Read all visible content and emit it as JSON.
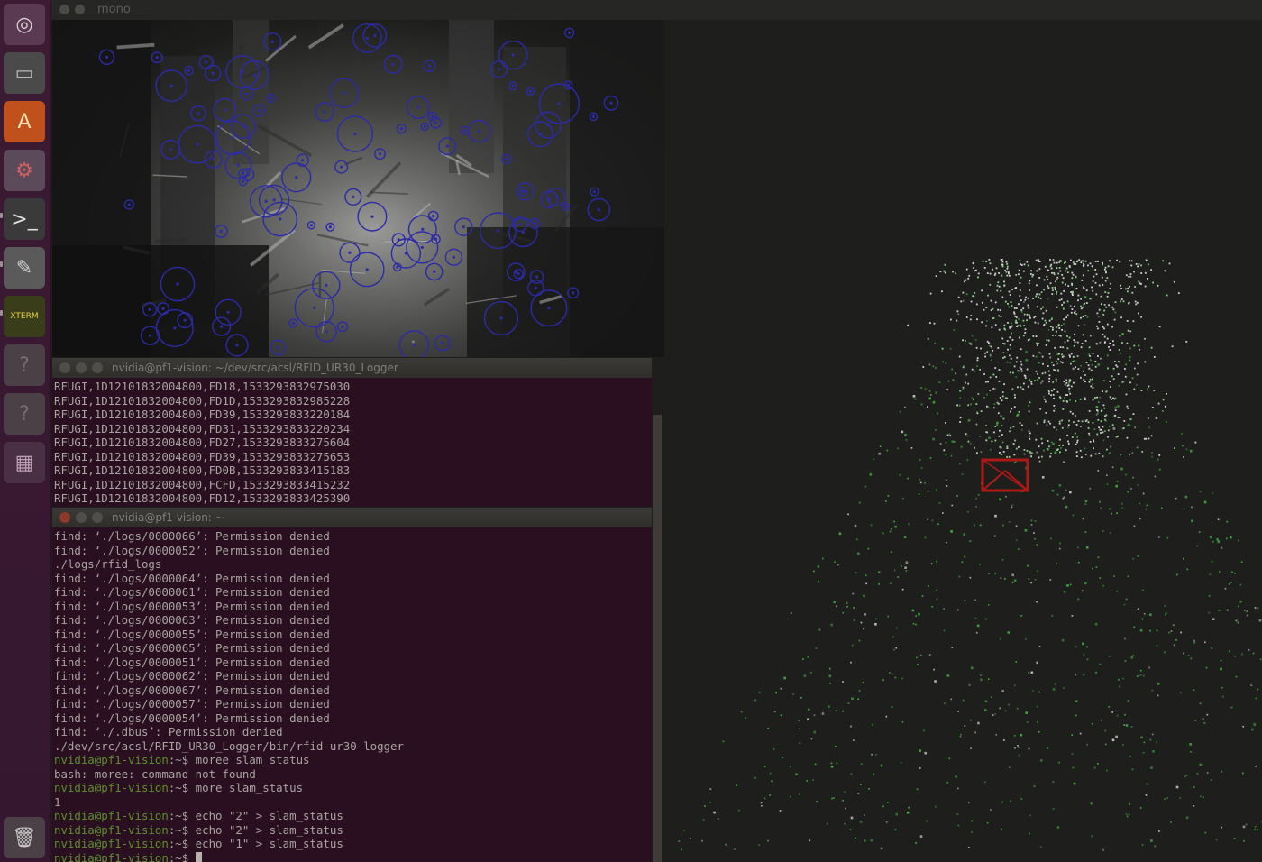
{
  "top_panel": {
    "title": "mono"
  },
  "launcher": {
    "items": [
      {
        "name": "dash-home-icon",
        "glyph": "◎"
      },
      {
        "name": "file-manager-icon",
        "glyph": "▭"
      },
      {
        "name": "software-center-icon",
        "glyph": "A"
      },
      {
        "name": "system-settings-icon",
        "glyph": "⚙"
      },
      {
        "name": "terminal-icon",
        "glyph": ">_"
      },
      {
        "name": "text-editor-icon",
        "glyph": "✎"
      },
      {
        "name": "xterm-icon",
        "glyph": "XTERM"
      },
      {
        "name": "unknown-app-icon",
        "glyph": "?"
      },
      {
        "name": "unknown-app-icon-2",
        "glyph": "?"
      },
      {
        "name": "workspace-switcher-icon",
        "glyph": "▦"
      },
      {
        "name": "trash-icon",
        "glyph": "🗑"
      }
    ]
  },
  "logger_terminal": {
    "title": "nvidia@pf1-vision: ~/dev/src/acsl/RFID_UR30_Logger",
    "lines": [
      "RFUGI,1D12101832004800,FD18,1533293832975030",
      "RFUGI,1D12101832004800,FD1D,1533293832985228",
      "RFUGI,1D12101832004800,FD39,1533293833220184",
      "RFUGI,1D12101832004800,FD31,1533293833220234",
      "RFUGI,1D12101832004800,FD27,1533293833275604",
      "RFUGI,1D12101832004800,FD39,1533293833275653",
      "RFUGI,1D12101832004800,FD0B,1533293833415183",
      "RFUGI,1D12101832004800,FCFD,1533293833415232",
      "RFUGI,1D12101832004800,FD12,1533293833425390"
    ]
  },
  "shell_terminal": {
    "title": "nvidia@pf1-vision: ~",
    "lines": [
      {
        "text": "find: ‘./logs/0000066’: Permission denied"
      },
      {
        "text": "find: ‘./logs/0000052’: Permission denied"
      },
      {
        "text": "./logs/rfid_logs"
      },
      {
        "text": "find: ‘./logs/0000064’: Permission denied"
      },
      {
        "text": "find: ‘./logs/0000061’: Permission denied"
      },
      {
        "text": "find: ‘./logs/0000053’: Permission denied"
      },
      {
        "text": "find: ‘./logs/0000063’: Permission denied"
      },
      {
        "text": "find: ‘./logs/0000055’: Permission denied"
      },
      {
        "text": "find: ‘./logs/0000065’: Permission denied"
      },
      {
        "text": "find: ‘./logs/0000051’: Permission denied"
      },
      {
        "text": "find: ‘./logs/0000062’: Permission denied"
      },
      {
        "text": "find: ‘./logs/0000067’: Permission denied"
      },
      {
        "text": "find: ‘./logs/0000057’: Permission denied"
      },
      {
        "text": "find: ‘./logs/0000054’: Permission denied"
      },
      {
        "text": "find: ‘./.dbus’: Permission denied"
      },
      {
        "text": "./dev/src/acsl/RFID_UR30_Logger/bin/rfid-ur30-logger"
      },
      {
        "prompt": "nvidia@pf1-vision",
        "text": ":~$ moree slam_status"
      },
      {
        "text": "bash: moree: command not found"
      },
      {
        "prompt": "nvidia@pf1-vision",
        "text": ":~$ more slam_status"
      },
      {
        "text": "1"
      },
      {
        "prompt": "nvidia@pf1-vision",
        "text": ":~$ echo \"2\" > slam_status"
      },
      {
        "prompt": "nvidia@pf1-vision",
        "text": ":~$ echo \"2\" > slam_status"
      },
      {
        "prompt": "nvidia@pf1-vision",
        "text": ":~$ echo \"1\" > slam_status"
      },
      {
        "prompt": "nvidia@pf1-vision",
        "text": ":~$ ",
        "cursor": true
      }
    ]
  },
  "colors": {
    "terminal_bg": "#2a0f21",
    "prompt_green": "#5c8f2c",
    "keypoint_blue": "#2b2ba8",
    "map_points_white": "#cfcfcf",
    "map_points_green": "#3fae3a",
    "camera_pose_red": "#b01818"
  }
}
